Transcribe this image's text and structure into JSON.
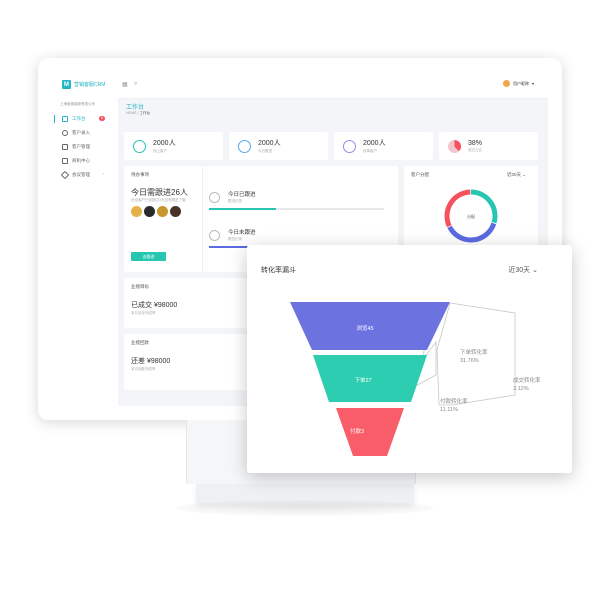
{
  "app": {
    "logo_mark": "M",
    "name": "营销客服CRM",
    "company": "上海营销客服有限公司"
  },
  "sidebar": {
    "items": [
      {
        "label": "工作台",
        "badge": "6"
      },
      {
        "label": "客户录入"
      },
      {
        "label": "客户管理"
      },
      {
        "label": "商机中心"
      },
      {
        "label": "会议管理",
        "caret": "›"
      }
    ]
  },
  "topbar": {
    "grid_icon": "grid-icon",
    "search_icon": "search-icon",
    "user_name": "用户昵称",
    "caret": "▾"
  },
  "page": {
    "title": "工作台",
    "breadcrumb_home": "HOME",
    "breadcrumb_sep": "/",
    "breadcrumb_current": "工作台"
  },
  "stats": [
    {
      "value": "2000人",
      "label": "线上客户",
      "color": "#27c6b1"
    },
    {
      "value": "2000人",
      "label": "今日跟进",
      "color": "#5aa8e8"
    },
    {
      "value": "2000人",
      "label": "成单客户",
      "color": "#8c8ef0"
    },
    {
      "value": "38%",
      "label": "成交占比",
      "color": "#f5515f"
    }
  ],
  "tasks": {
    "title": "待办事项",
    "today_count": "今日需跟进26人",
    "note": "还没客户已经超过3天没有跟进了哦",
    "button": "去跟进",
    "followed": {
      "label": "今日已跟进",
      "sub": "跟进记录",
      "progress": 0.38
    },
    "unfollowed": {
      "label": "今日未跟进",
      "sub": "跟进记录",
      "progress": 0.38
    }
  },
  "customer_dist": {
    "title": "客户分配",
    "period": "近30天",
    "center": "分配",
    "segments": [
      0.3,
      0.38,
      0.32
    ]
  },
  "sales_target": {
    "title": "业绩目标",
    "value": "已成交 ¥98000",
    "sub": "本月目标完成率"
  },
  "sales_collect": {
    "title": "业绩回款",
    "value": "还差 ¥98000",
    "sub": "本月回款完成率"
  },
  "funnel": {
    "title": "转化率漏斗",
    "period": "近30天",
    "stages": [
      {
        "label": "浏览45",
        "color": "#6c73e0"
      },
      {
        "label": "下单27",
        "color": "#2ccdb1"
      },
      {
        "label": "付款3",
        "color": "#fa5d6a"
      }
    ],
    "rates": [
      {
        "label": "下单转化率",
        "value": "31.76%"
      },
      {
        "label": "付款转化率",
        "value": "11.11%"
      },
      {
        "label": "成交转化率",
        "value": "3.12%"
      }
    ]
  }
}
